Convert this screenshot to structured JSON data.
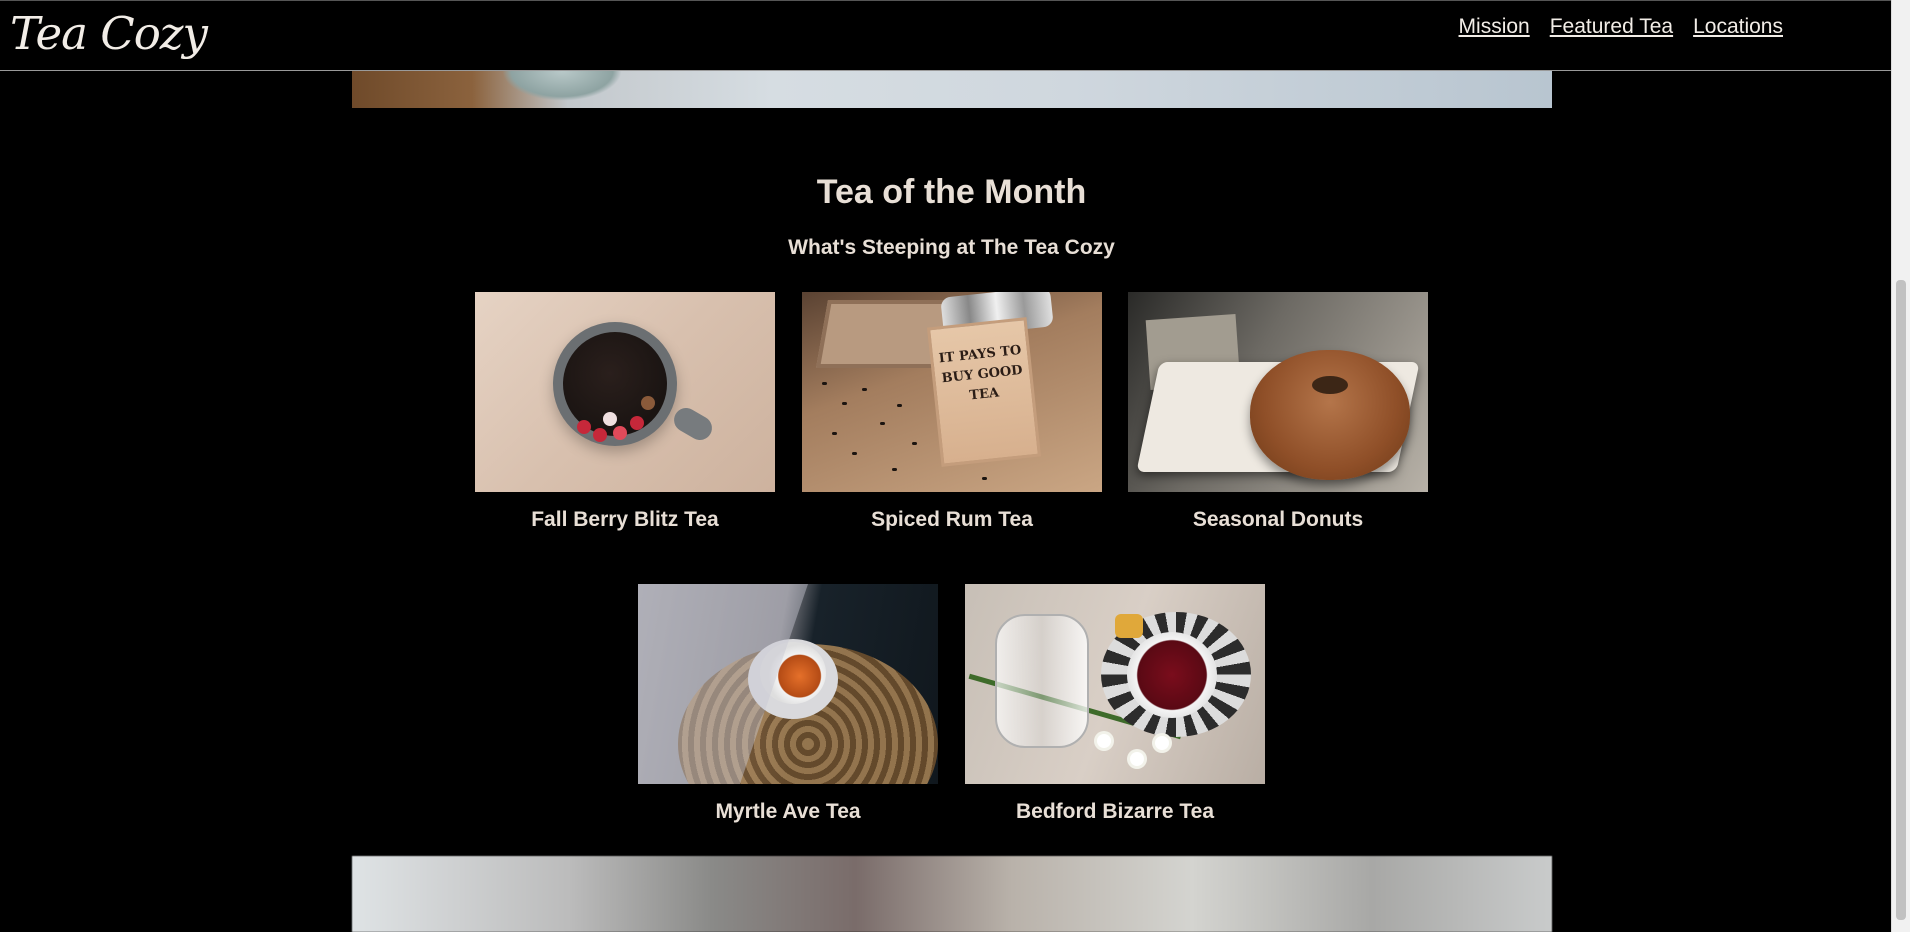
{
  "header": {
    "logo_text": "Tea Cozy",
    "nav": [
      {
        "label": "Mission"
      },
      {
        "label": "Featured Tea"
      },
      {
        "label": "Locations"
      }
    ]
  },
  "section": {
    "title": "Tea of the Month",
    "subtitle": "What's Steeping at The Tea Cozy",
    "items": [
      {
        "caption": "Fall Berry Blitz Tea"
      },
      {
        "caption": "Spiced Rum Tea"
      },
      {
        "caption": "Seasonal Donuts"
      },
      {
        "caption": "Myrtle Ave Tea"
      },
      {
        "caption": "Bedford Bizarre Tea"
      }
    ]
  },
  "photo_text": {
    "box_label": "IT PAYS TO BUY GOOD TEA"
  },
  "colors": {
    "background": "#000000",
    "text": "#e8dfd6",
    "nav_link": "#f2ede7"
  }
}
